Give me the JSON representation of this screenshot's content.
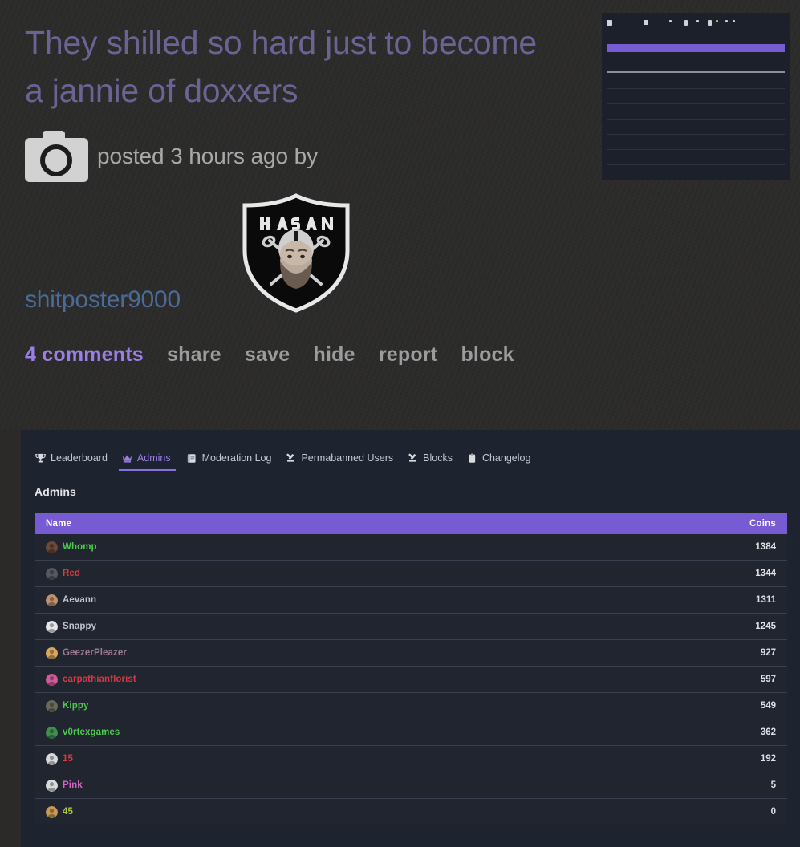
{
  "post": {
    "title": "They shilled so hard just to become a jannie of doxxers",
    "posted_text": "posted 3 hours ago by",
    "username": "shitposter9000",
    "camera_icon": "camera-icon",
    "avatar_icon": "hasan-raiders-shield-logo",
    "thumbnail_icon": "post-thumbnail-preview",
    "actions": [
      {
        "label": "4 comments",
        "accent": true
      },
      {
        "label": "share",
        "accent": false
      },
      {
        "label": "save",
        "accent": false
      },
      {
        "label": "hide",
        "accent": false
      },
      {
        "label": "report",
        "accent": false
      },
      {
        "label": "block",
        "accent": false
      }
    ]
  },
  "panel": {
    "tabs": [
      {
        "label": "Leaderboard",
        "icon": "trophy-icon",
        "active": false
      },
      {
        "label": "Admins",
        "icon": "crown-icon",
        "active": true
      },
      {
        "label": "Moderation Log",
        "icon": "scroll-icon",
        "active": false
      },
      {
        "label": "Permabanned Users",
        "icon": "gavel-icon",
        "active": false
      },
      {
        "label": "Blocks",
        "icon": "gavel-icon",
        "active": false
      },
      {
        "label": "Changelog",
        "icon": "clipboard-icon",
        "active": false
      }
    ],
    "section_title": "Admins",
    "table": {
      "columns": {
        "name": "Name",
        "coins": "Coins"
      },
      "rows": [
        {
          "name": "Whomp",
          "coins": "1384",
          "color": "#4ec94e",
          "avatar_bg": "#6b4a38"
        },
        {
          "name": "Red",
          "coins": "1344",
          "color": "#e03a3a",
          "avatar_bg": "#55585e"
        },
        {
          "name": "Aevann",
          "coins": "1311",
          "color": "#bfc3cc",
          "avatar_bg": "#c09070"
        },
        {
          "name": "Snappy",
          "coins": "1245",
          "color": "#bfc3cc",
          "avatar_bg": "#e4e6ea"
        },
        {
          "name": "GeezerPleazer",
          "coins": "927",
          "color": "#9e7b90",
          "avatar_bg": "#d8a860"
        },
        {
          "name": "carpathianflorist",
          "coins": "597",
          "color": "#d43a46",
          "avatar_bg": "#d05a9a"
        },
        {
          "name": "Kippy",
          "coins": "549",
          "color": "#4ec94e",
          "avatar_bg": "#6a6a5a"
        },
        {
          "name": "v0rtexgames",
          "coins": "362",
          "color": "#4ec94e",
          "avatar_bg": "#3f8f4f"
        },
        {
          "name": "15",
          "coins": "192",
          "color": "#e03a3a",
          "avatar_bg": "#d8dade"
        },
        {
          "name": "Pink",
          "coins": "5",
          "color": "#d463c9",
          "avatar_bg": "#d8dade"
        },
        {
          "name": "45",
          "coins": "0",
          "color": "#aacc3a",
          "avatar_bg": "#c89a52"
        }
      ]
    }
  },
  "colors": {
    "page_background": "#2b2a29",
    "panel_background": "#1e2330",
    "title_purple": "#6a6393",
    "accent_purple": "#9b7fe8",
    "header_purple": "#775bd2",
    "username_blue": "#4a6b96",
    "row_background": "#21252f",
    "row_divider": "#39404f"
  }
}
